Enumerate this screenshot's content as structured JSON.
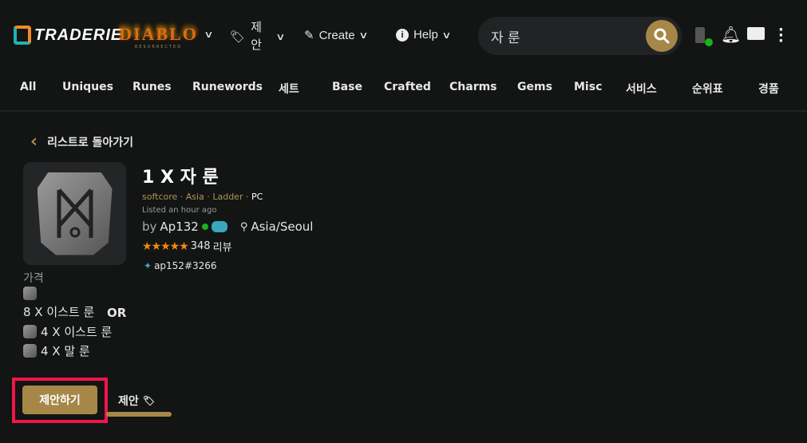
{
  "header": {
    "logo_text": "TRADERIE",
    "game_logo": "DIABLO II RESURRECTED",
    "menus": [
      {
        "label": "제안",
        "icon": "tag-icon"
      },
      {
        "label": "Create",
        "icon": "edit-icon"
      },
      {
        "label": "Help",
        "icon": "info-icon"
      }
    ],
    "search": {
      "value": "자 룬"
    },
    "colors": {
      "accent": "#a68748",
      "online": "#1ab31a",
      "highlight": "#f0154a"
    }
  },
  "nav": {
    "items": [
      "All",
      "Uniques",
      "Runes",
      "Runewords",
      "세트",
      "Base",
      "Crafted",
      "Charms",
      "Gems",
      "Misc",
      "서비스",
      "순위표",
      "경품"
    ]
  },
  "back_label": "리스트로 돌아가기",
  "listing": {
    "title": "1 X 자 룬",
    "mode": "softcore",
    "region": "Asia",
    "ladder": "Ladder",
    "platform": "PC",
    "listed": "Listed an hour ago",
    "by": "by",
    "user": "Ap132",
    "location": "Asia/Seoul",
    "rating": 5,
    "reviews_count": "348",
    "reviews_label": "리뷰",
    "battlenet": "ap152#3266"
  },
  "price": {
    "label": "가격",
    "option1": [
      "8 X 이스트 룬"
    ],
    "or": "OR",
    "option2": [
      "4 X 이스트 룬",
      "4 X 말 룬"
    ]
  },
  "actions": {
    "offer_button": "제안하기",
    "offers_tab": "제안"
  }
}
